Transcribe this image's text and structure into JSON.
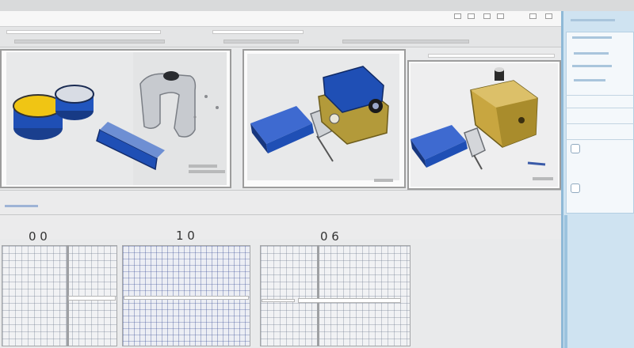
{
  "viewports": {
    "left": {
      "caption": ""
    },
    "center": {
      "caption": ""
    },
    "right": {
      "caption": ""
    }
  },
  "grids": {
    "left": {
      "label": "0 0"
    },
    "center": {
      "label": "1 0"
    },
    "right": {
      "label": "0 6"
    }
  },
  "colors": {
    "blue_part": "#1f4fb5",
    "gold_part": "#b39a3a",
    "yellow_face": "#f0c514",
    "panel_accent": "#cfe3f1"
  },
  "icons": {
    "minimize": "minimize-icon",
    "maximize": "maximize-icon",
    "close": "close-icon"
  }
}
